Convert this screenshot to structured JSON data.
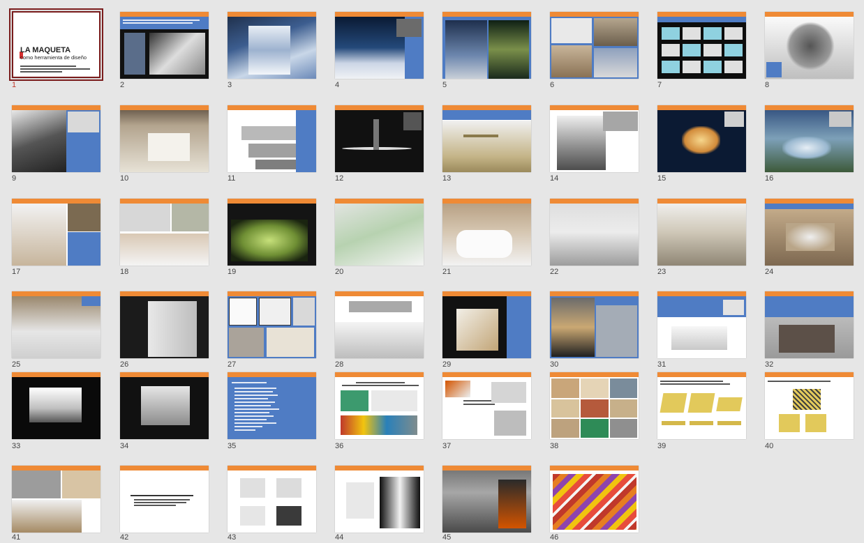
{
  "slide1": {
    "title": "LA MAQUETA",
    "subtitle": "como herramienta de diseño"
  },
  "colors": {
    "accent_orange": "#ef8a35",
    "accent_blue": "#4f7cc4",
    "selected_border": "#7a1c1c",
    "background": "#e6e6e6"
  },
  "slides": [
    {
      "n": "1",
      "kind": "title"
    },
    {
      "n": "2",
      "kind": "text-photo"
    },
    {
      "n": "3",
      "kind": "photo"
    },
    {
      "n": "4",
      "kind": "photo-blue"
    },
    {
      "n": "5",
      "kind": "photo-blue"
    },
    {
      "n": "6",
      "kind": "collage"
    },
    {
      "n": "7",
      "kind": "dark-grid"
    },
    {
      "n": "8",
      "kind": "photo"
    },
    {
      "n": "9",
      "kind": "photo-blue"
    },
    {
      "n": "10",
      "kind": "photo"
    },
    {
      "n": "11",
      "kind": "photo"
    },
    {
      "n": "12",
      "kind": "dark"
    },
    {
      "n": "13",
      "kind": "text-photo"
    },
    {
      "n": "14",
      "kind": "photo"
    },
    {
      "n": "15",
      "kind": "dark"
    },
    {
      "n": "16",
      "kind": "photo"
    },
    {
      "n": "17",
      "kind": "photo-blue"
    },
    {
      "n": "18",
      "kind": "photo"
    },
    {
      "n": "19",
      "kind": "dark"
    },
    {
      "n": "20",
      "kind": "photo"
    },
    {
      "n": "21",
      "kind": "photo"
    },
    {
      "n": "22",
      "kind": "photo"
    },
    {
      "n": "23",
      "kind": "photo"
    },
    {
      "n": "24",
      "kind": "photo"
    },
    {
      "n": "25",
      "kind": "photo"
    },
    {
      "n": "26",
      "kind": "photo"
    },
    {
      "n": "27",
      "kind": "collage"
    },
    {
      "n": "28",
      "kind": "photo"
    },
    {
      "n": "29",
      "kind": "photo-blue"
    },
    {
      "n": "30",
      "kind": "photo-blue"
    },
    {
      "n": "31",
      "kind": "photo-blue"
    },
    {
      "n": "32",
      "kind": "photo-blue"
    },
    {
      "n": "33",
      "kind": "dark"
    },
    {
      "n": "34",
      "kind": "dark"
    },
    {
      "n": "35",
      "kind": "blue-list"
    },
    {
      "n": "36",
      "kind": "white-tools"
    },
    {
      "n": "37",
      "kind": "white-tools"
    },
    {
      "n": "38",
      "kind": "collage"
    },
    {
      "n": "39",
      "kind": "white-diagram"
    },
    {
      "n": "40",
      "kind": "white-diagram"
    },
    {
      "n": "41",
      "kind": "collage"
    },
    {
      "n": "42",
      "kind": "white-text"
    },
    {
      "n": "43",
      "kind": "white-diagram"
    },
    {
      "n": "44",
      "kind": "white-diagram"
    },
    {
      "n": "45",
      "kind": "photo"
    },
    {
      "n": "46",
      "kind": "photo"
    }
  ]
}
